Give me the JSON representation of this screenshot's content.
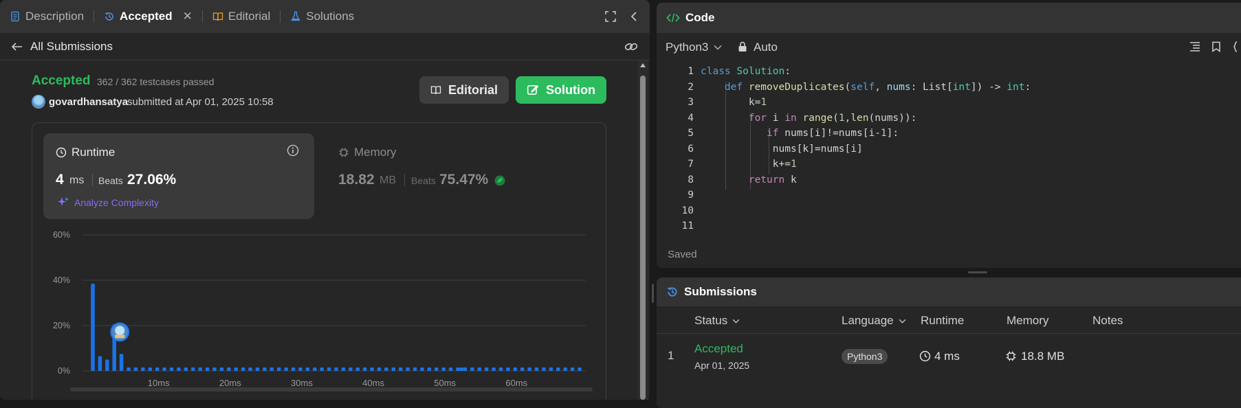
{
  "left": {
    "tabs": [
      {
        "label": "Description"
      },
      {
        "label": "Accepted"
      },
      {
        "label": "Editorial"
      },
      {
        "label": "Solutions"
      }
    ],
    "back_label": "All Submissions",
    "status": "Accepted",
    "testcases": "362 / 362 testcases passed",
    "username": "govardhansatya",
    "submitted_text": "submitted at Apr 01, 2025 10:58",
    "editorial_button": "Editorial",
    "solution_button": "Solution",
    "runtime": {
      "title": "Runtime",
      "value": "4",
      "unit": "ms",
      "beats_label": "Beats",
      "beats_value": "27.06%",
      "analyze": "Analyze Complexity"
    },
    "memory": {
      "title": "Memory",
      "value": "18.82",
      "unit": "MB",
      "beats_label": "Beats",
      "beats_value": "75.47%"
    }
  },
  "chart_data": {
    "type": "bar",
    "y_ticks": [
      "60%",
      "40%",
      "20%",
      "0%"
    ],
    "x_ticks": [
      "10ms",
      "20ms",
      "30ms",
      "40ms",
      "50ms",
      "60ms"
    ],
    "ylim": [
      0,
      60
    ],
    "x": [
      1,
      2,
      3,
      4,
      5,
      6,
      7,
      8,
      9,
      10,
      11,
      12,
      13,
      14,
      15,
      16,
      17,
      18,
      19,
      20,
      21,
      22,
      23,
      24,
      25,
      26,
      27,
      28,
      29,
      30,
      31,
      32,
      33,
      34,
      35,
      36,
      37,
      38,
      39,
      40,
      41,
      42,
      43,
      44,
      45,
      46,
      47,
      48,
      49,
      50,
      51,
      52,
      52.5,
      53,
      54,
      55,
      56,
      57,
      58,
      59,
      60,
      61,
      62,
      63,
      64,
      65,
      66,
      67,
      68,
      69
    ],
    "values": [
      38.5,
      6.5,
      5,
      20.5,
      7.5,
      1.5,
      1.5,
      1.5,
      1.5,
      1.5,
      1.5,
      1.5,
      1.5,
      1.5,
      1.5,
      1.5,
      1.5,
      1.5,
      1.5,
      1.5,
      1.5,
      1.5,
      1.5,
      1.5,
      1.5,
      1.5,
      1.5,
      1.5,
      1.5,
      1.5,
      1.5,
      1.5,
      1.5,
      1.5,
      1.5,
      1.5,
      1.5,
      1.5,
      1.5,
      1.5,
      1.5,
      1.5,
      1.5,
      1.5,
      1.5,
      1.5,
      1.5,
      1.5,
      1.5,
      1.5,
      1.5,
      1.5,
      1.5,
      1.5,
      1.5,
      1.5,
      1.5,
      1.5,
      1.5,
      1.5,
      1.5,
      1.5,
      1.5,
      1.5,
      1.5,
      1.5,
      1.5,
      1.5,
      1.5,
      1.5
    ],
    "highlight_index": 3,
    "bar_color": "#1a73e8"
  },
  "code": {
    "title": "Code",
    "language": "Python3",
    "mode": "Auto",
    "saved": "Saved",
    "line_numbers": [
      "1",
      "2",
      "3",
      "4",
      "5",
      "6",
      "7",
      "8",
      "9",
      "10",
      "11"
    ],
    "lines": [
      [
        [
          "class ",
          "#569cd6"
        ],
        [
          "Solution",
          "#4ec9b0"
        ],
        [
          ":",
          "#d4d4d4"
        ]
      ],
      [
        [
          "    ",
          ""
        ],
        [
          "def ",
          "#569cd6"
        ],
        [
          "removeDuplicates",
          "#dcdcaa"
        ],
        [
          "(",
          "#d4d4d4"
        ],
        [
          "self",
          "#569cd6"
        ],
        [
          ", ",
          "#d4d4d4"
        ],
        [
          "nums",
          "#9cdcfe"
        ],
        [
          ": List[",
          "#d4d4d4"
        ],
        [
          "int",
          "#4ec9b0"
        ],
        [
          "]) -> ",
          "#d4d4d4"
        ],
        [
          "int",
          "#4ec9b0"
        ],
        [
          ":",
          "#d4d4d4"
        ]
      ],
      [
        [
          "        ",
          ""
        ],
        [
          "k",
          "#d4d4d4"
        ],
        [
          "=",
          "#d4d4d4"
        ],
        [
          "1",
          "#b5cea8"
        ]
      ],
      [
        [
          "        ",
          ""
        ],
        [
          "for ",
          "#c586c0"
        ],
        [
          "i ",
          "#d4d4d4"
        ],
        [
          "in ",
          "#c586c0"
        ],
        [
          "range",
          "#dcdcaa"
        ],
        [
          "(",
          "#d4d4d4"
        ],
        [
          "1",
          "#b5cea8"
        ],
        [
          ",",
          "#d4d4d4"
        ],
        [
          "len",
          "#dcdcaa"
        ],
        [
          "(nums)):",
          "#d4d4d4"
        ]
      ],
      [
        [
          "           ",
          ""
        ],
        [
          "if ",
          "#c586c0"
        ],
        [
          "nums[i]!=nums[i-",
          "#d4d4d4"
        ],
        [
          "1",
          "#b5cea8"
        ],
        [
          "]:",
          "#d4d4d4"
        ]
      ],
      [
        [
          "            ",
          ""
        ],
        [
          "nums[k]=nums[i]",
          "#d4d4d4"
        ]
      ],
      [
        [
          "            ",
          ""
        ],
        [
          "k+=",
          "#d4d4d4"
        ],
        [
          "1",
          "#b5cea8"
        ]
      ],
      [
        [
          "        ",
          ""
        ],
        [
          "return ",
          "#c586c0"
        ],
        [
          "k",
          "#d4d4d4"
        ]
      ],
      [],
      [],
      []
    ]
  },
  "submissions": {
    "title": "Submissions",
    "columns": [
      "Status",
      "Language",
      "Runtime",
      "Memory",
      "Notes"
    ],
    "rows": [
      {
        "index": "1",
        "status": "Accepted",
        "date": "Apr 01, 2025",
        "language": "Python3",
        "runtime": "4 ms",
        "memory": "18.8 MB"
      }
    ]
  },
  "colors": {
    "accepted_green": "#2cbb5d",
    "solution_button": "#2cbb5d",
    "blue_bar": "#1a73e8",
    "analyze_purple": "#8b6cf0"
  }
}
